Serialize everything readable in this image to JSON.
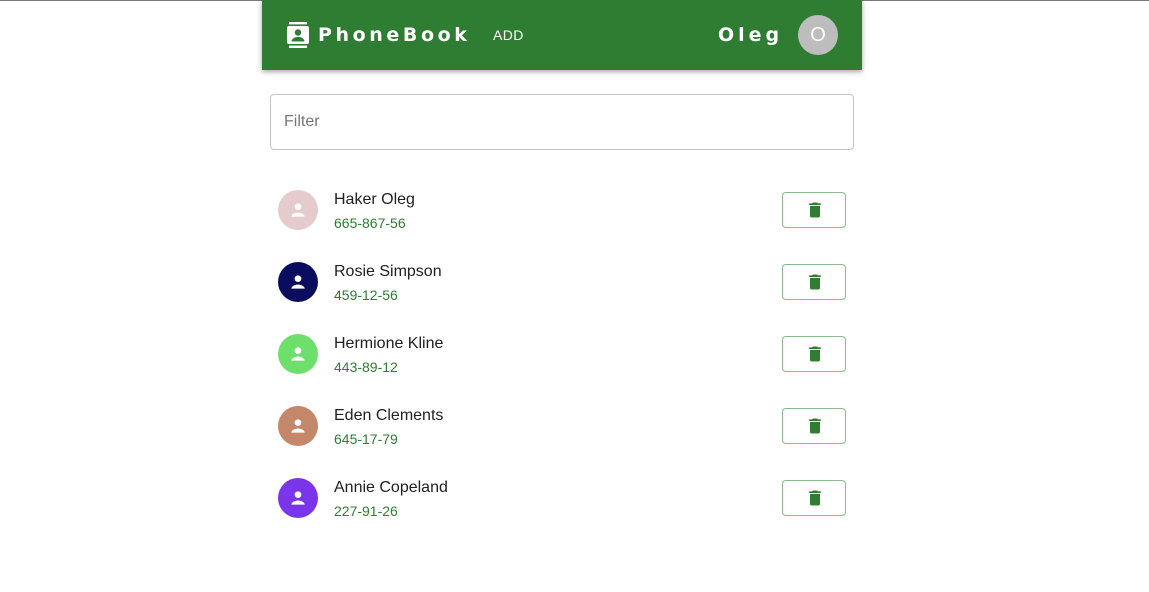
{
  "appbar": {
    "brand": "PhoneBook",
    "nav_add": "ADD",
    "username": "Oleg",
    "avatar_initial": "O",
    "color": "#2e7d32",
    "logo_icon": "contacts-book-icon"
  },
  "filter": {
    "placeholder": "Filter",
    "value": ""
  },
  "contacts": [
    {
      "name": "Haker Oleg",
      "phone": "665-867-56",
      "avatar_color": "#e5cbcb",
      "icon": "person-icon"
    },
    {
      "name": "Rosie Simpson",
      "phone": "459-12-56",
      "avatar_color": "#0a0d5f",
      "icon": "person-icon"
    },
    {
      "name": "Hermione Kline",
      "phone": "443-89-12",
      "avatar_color": "#6de06b",
      "icon": "person-icon"
    },
    {
      "name": "Eden Clements",
      "phone": "645-17-79",
      "avatar_color": "#c4876a",
      "icon": "person-icon"
    },
    {
      "name": "Annie Copeland",
      "phone": "227-91-26",
      "avatar_color": "#7a35ea",
      "icon": "person-icon"
    }
  ],
  "delete_icon": "trash-icon",
  "accent_color": "#2e7d32"
}
